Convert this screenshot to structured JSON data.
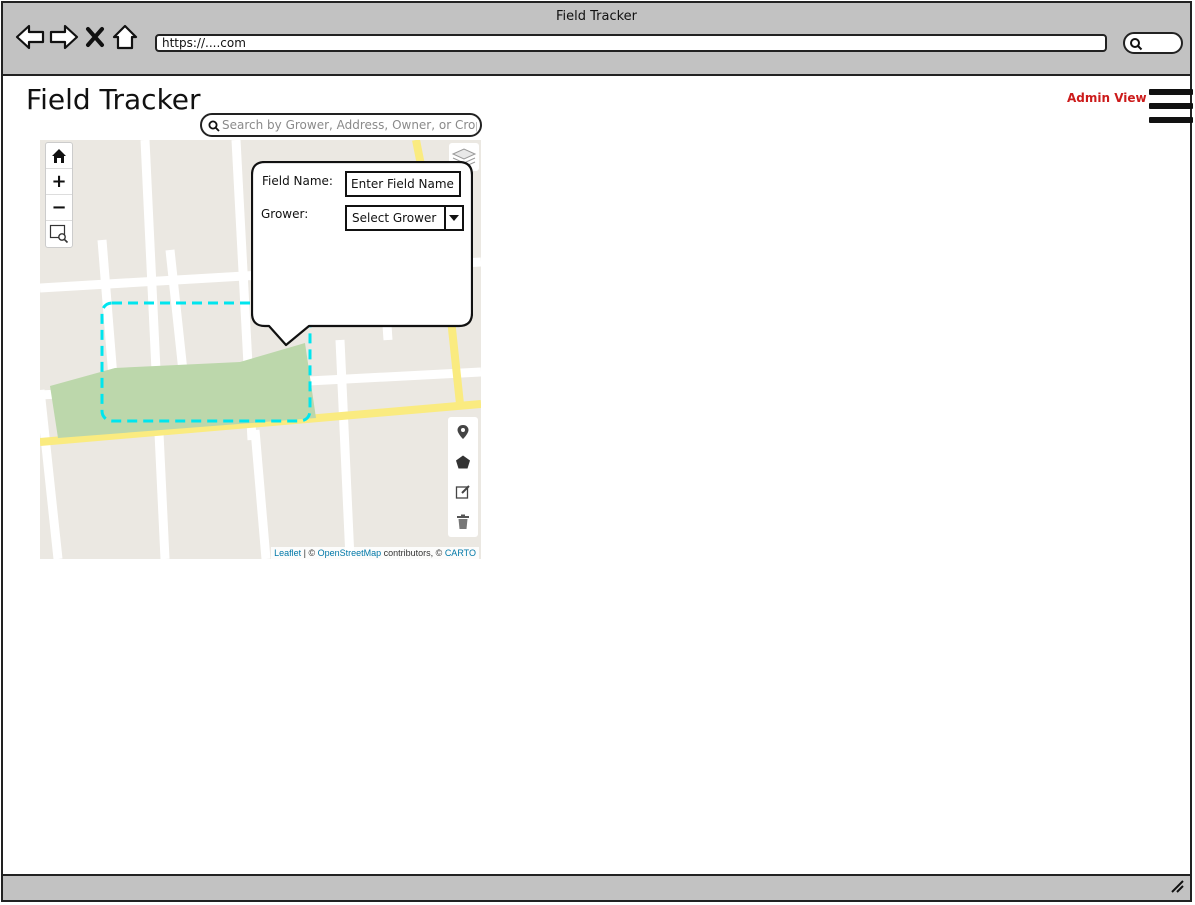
{
  "window": {
    "title": "Field Tracker",
    "url": "https://....com"
  },
  "app": {
    "title": "Field Tracker",
    "admin_link": "Admin View"
  },
  "search": {
    "placeholder": "Search by Grower, Address, Owner, or Crop"
  },
  "map": {
    "attribution": {
      "leaflet": "Leaflet",
      "sep": " | © ",
      "osm": "OpenStreetMap",
      "contrib": " contributors, © ",
      "carto": "CARTO"
    },
    "zoom_in": "+",
    "zoom_out": "−",
    "colors": {
      "background": "#ebe8e2",
      "road": "#ffffff",
      "major_road": "#faeb80",
      "field": "#bcd7ab",
      "selection": "#00e5ee"
    }
  },
  "popup": {
    "field_name_label": "Field Name:",
    "field_name_placeholder": "Enter Field Name",
    "grower_label": "Grower:",
    "grower_selected": "Select Grower"
  }
}
